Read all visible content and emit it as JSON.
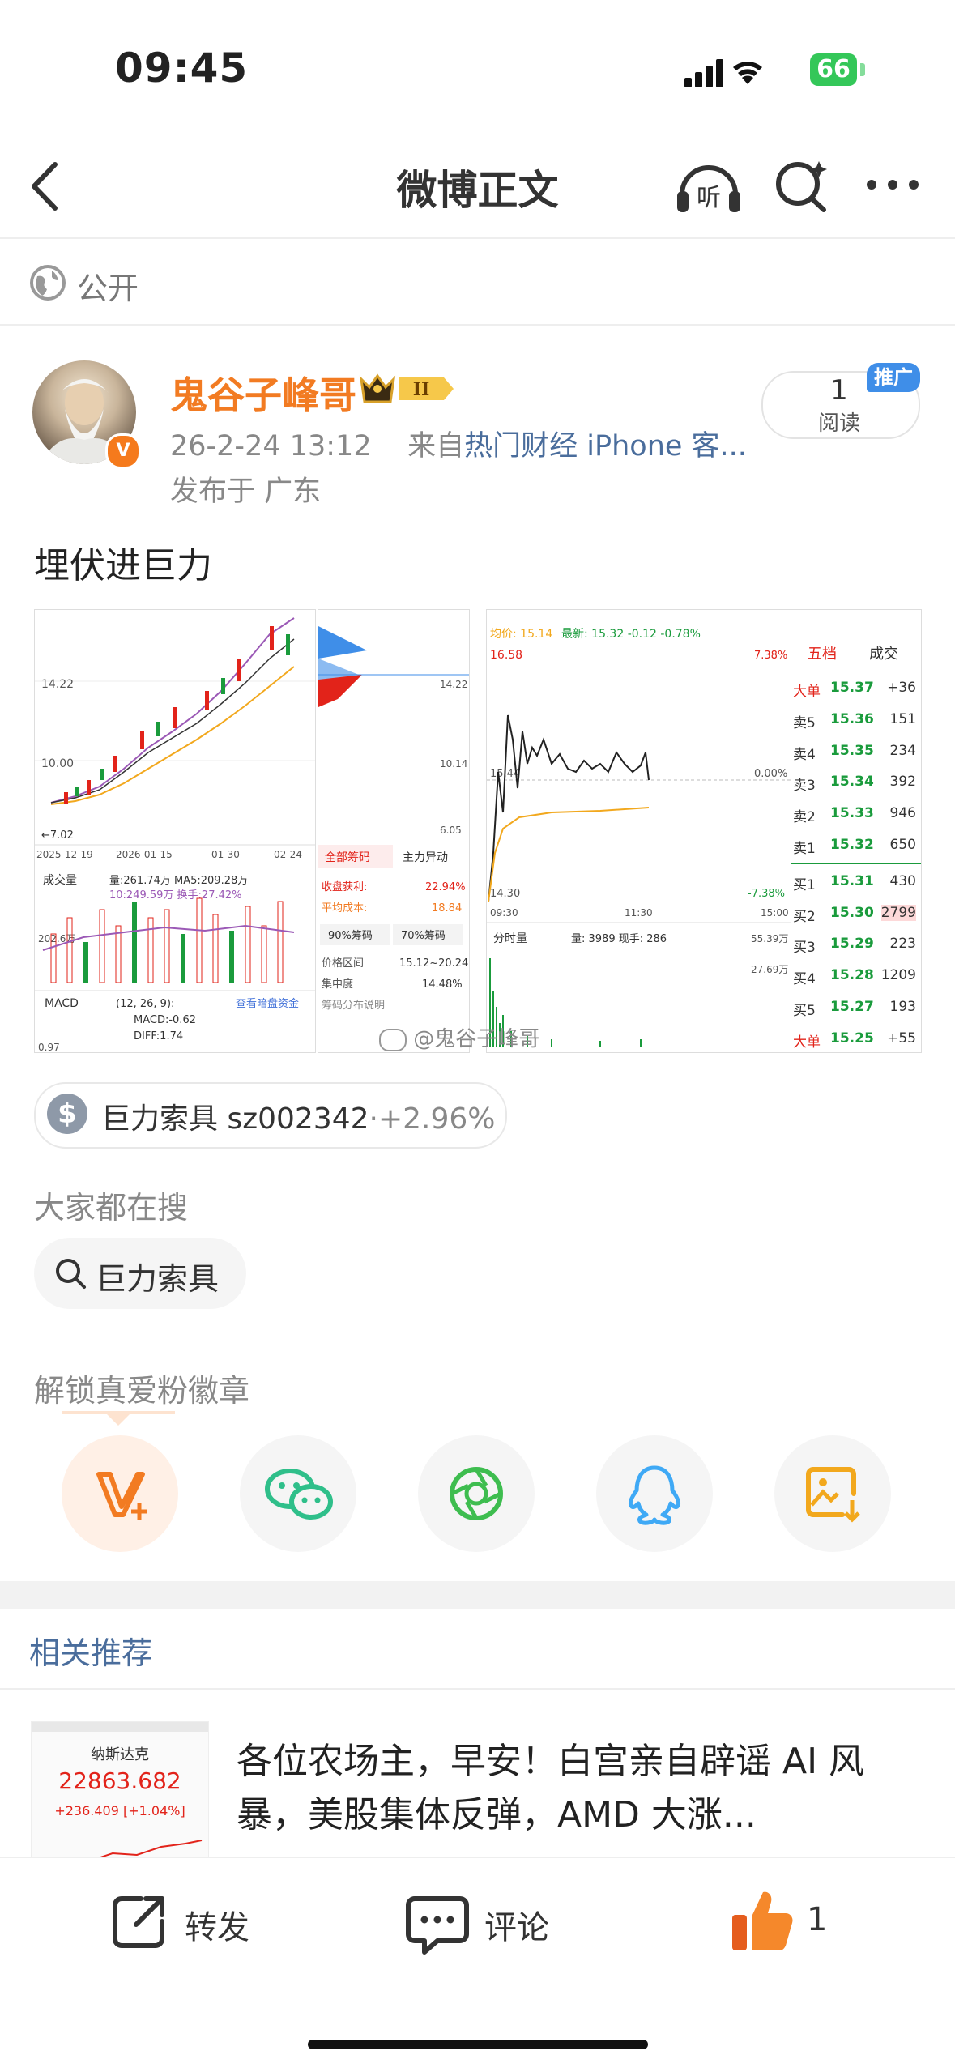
{
  "status_bar": {
    "time": "09:45",
    "battery": "66"
  },
  "nav": {
    "title": "微博正文"
  },
  "visibility": {
    "label": "公开"
  },
  "author": {
    "name": "鬼谷子峰哥",
    "level_badge": "II",
    "timestamp": "26-2-24 13:12",
    "source_prefix": "来自",
    "source": "热门财经 iPhone 客...",
    "location": "发布于 广东"
  },
  "reads": {
    "count": "1",
    "label": "阅读",
    "promo": "推广"
  },
  "post": {
    "text": "埋伏进巨力"
  },
  "images": {
    "img1": {
      "y_high": "14.22",
      "y_mid": "10.00",
      "low": "←7.02",
      "dates": [
        "2025-12-19",
        "2026-01-15",
        "01-30",
        "02-24"
      ],
      "vol_label": "成交量",
      "vol_text": "量:261.74万  MA5:209.28万",
      "vol_text2": "10:249.59万  换手:27.42%",
      "vol_axis": "202.6万",
      "macd_label": "MACD",
      "macd_params": "(12, 26, 9):",
      "macd_link": "查看暗盘资金",
      "macd_val": "MACD:-0.62",
      "diff_val": "DIFF:1.74",
      "macd_axis": "0.97",
      "watermark": "@鬼谷子峰哥"
    },
    "img2": {
      "y_labels": [
        "14.22",
        "10.14",
        "6.05"
      ],
      "tab1": "全部筹码",
      "tab2": "主力异动",
      "row1_label": "收盘获利:",
      "row1_val": "22.94%",
      "row2_label": "平均成本:",
      "row2_val": "18.84",
      "btn1": "90%筹码",
      "btn2": "70%筹码",
      "row3_label": "价格区间",
      "row3_val": "15.12~20.24",
      "row4_label": "集中度",
      "row4_val": "14.48%",
      "row5_label": "筹码分布说明"
    },
    "img3": {
      "avg": "均价: 15.14",
      "latest": "最新: 15.32  -0.12  -0.78%",
      "high": "16.58",
      "high_pct": "7.38%",
      "mid": "15.44",
      "mid_pct": "0.00%",
      "low": "14.30",
      "low_pct": "-7.38%",
      "times": [
        "09:30",
        "11:30",
        "15:00"
      ],
      "vol_label": "分时量",
      "vol_text": "量: 3989   现手: 286",
      "vol_axis1": "55.39万",
      "vol_axis2": "27.69万",
      "watermark": "@鬼谷子峰哥"
    },
    "img4": {
      "tab1": "五档",
      "tab2": "成交",
      "rows": [
        {
          "label": "大单",
          "price": "15.37",
          "vol": "+36",
          "side": "top"
        },
        {
          "label": "卖5",
          "price": "15.36",
          "vol": "151",
          "side": "sell"
        },
        {
          "label": "卖4",
          "price": "15.35",
          "vol": "234",
          "side": "sell"
        },
        {
          "label": "卖3",
          "price": "15.34",
          "vol": "392",
          "side": "sell"
        },
        {
          "label": "卖2",
          "price": "15.33",
          "vol": "946",
          "side": "sell"
        },
        {
          "label": "卖1",
          "price": "15.32",
          "vol": "650",
          "side": "sell"
        },
        {
          "label": "买1",
          "price": "15.31",
          "vol": "430",
          "side": "buy"
        },
        {
          "label": "买2",
          "price": "15.30",
          "vol": "2799",
          "side": "buy"
        },
        {
          "label": "买3",
          "price": "15.29",
          "vol": "223",
          "side": "buy"
        },
        {
          "label": "买4",
          "price": "15.28",
          "vol": "1209",
          "side": "buy"
        },
        {
          "label": "买5",
          "price": "15.27",
          "vol": "193",
          "side": "buy"
        },
        {
          "label": "大单",
          "price": "15.25",
          "vol": "+55",
          "side": "bottom"
        }
      ]
    },
    "overlay_watermark": "@鬼谷子峰哥"
  },
  "stock_tag": {
    "name": "巨力索具",
    "code": "sz002342",
    "change": "·+2.96%"
  },
  "search_section": {
    "title": "大家都在搜",
    "chip": "巨力索具"
  },
  "badge_section": {
    "title": "解锁真爱粉徽章"
  },
  "share_icons": [
    "vip-card-icon",
    "wechat-icon",
    "moments-icon",
    "qq-icon",
    "save-image-icon"
  ],
  "related": {
    "title": "相关推荐",
    "item": {
      "thumb_title": "纳斯达克",
      "thumb_value": "22863.682",
      "thumb_change": "+236.409 [+1.04%]",
      "headline": "各位农场主，早安！白宫亲自辟谣 AI 风暴，美股集体反弹，AMD 大涨..."
    }
  },
  "bottom_bar": {
    "repost": "转发",
    "comment": "评论",
    "like_count": "1"
  },
  "colors": {
    "brand_orange": "#f27b22",
    "link_blue": "#4a6d9c",
    "up_red": "#e2231a",
    "down_green": "#1a9b3c"
  }
}
